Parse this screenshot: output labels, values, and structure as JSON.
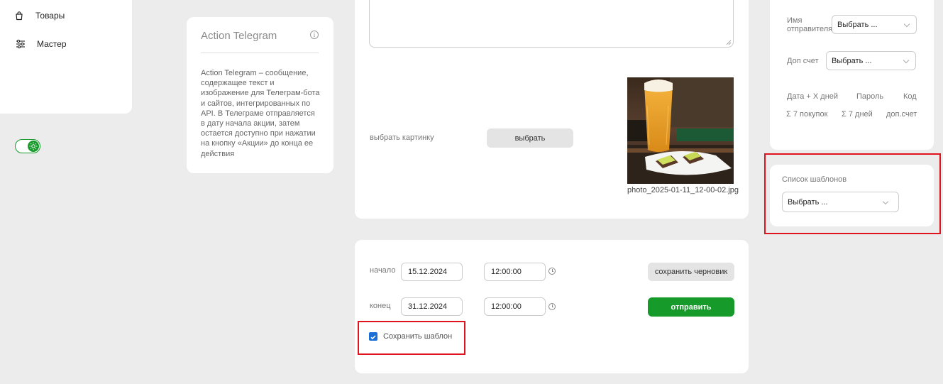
{
  "nav": {
    "items": [
      {
        "label": "Товары",
        "icon": "shopping-bag-icon"
      },
      {
        "label": "Мастер",
        "icon": "sliders-icon"
      }
    ]
  },
  "theme_toggle": {
    "icon": "sun-icon",
    "state": "on",
    "color": "#169a2a"
  },
  "info": {
    "title": "Action Telegram",
    "icon": "info-icon",
    "description": "Action Telegram – сообщение, содержащее текст и изображение для Телеграм-бота и сайтов, интегрированных по API. В Телеграме отправляется в дату начала акции, затем остается доступно при нажатии на кнопку «Акции» до конца ее действия"
  },
  "message": {
    "pick_image_label": "выбрать картинку",
    "pick_button": "выбрать",
    "photo_filename": "photo_2025-01-11_12-00-02.jpg"
  },
  "schedule": {
    "start_label": "начало",
    "start_date": "15.12.2024",
    "start_time": "12:00:00",
    "end_label": "конец",
    "end_date": "31.12.2024",
    "end_time": "12:00:00",
    "draft_button": "сохранить черновик",
    "send_button": "отправить",
    "save_template_label": "Сохранить шаблон",
    "save_template_checked": true
  },
  "sender": {
    "name_label": "Имя отправителя",
    "name_value": "Выбрать ...",
    "extra_label": "Доп счет",
    "extra_value": "Выбрать ...",
    "tags_row1": [
      "Дата + X дней",
      "Пароль",
      "Код"
    ],
    "tags_row2": [
      "Σ 7 покупок",
      "Σ 7 дней",
      "доп.счет"
    ]
  },
  "templates": {
    "label": "Список шаблонов",
    "value": "Выбрать ..."
  },
  "colors": {
    "accent": "#169a2a",
    "highlight": "#e0141e",
    "checkbox": "#1a6fd6"
  }
}
